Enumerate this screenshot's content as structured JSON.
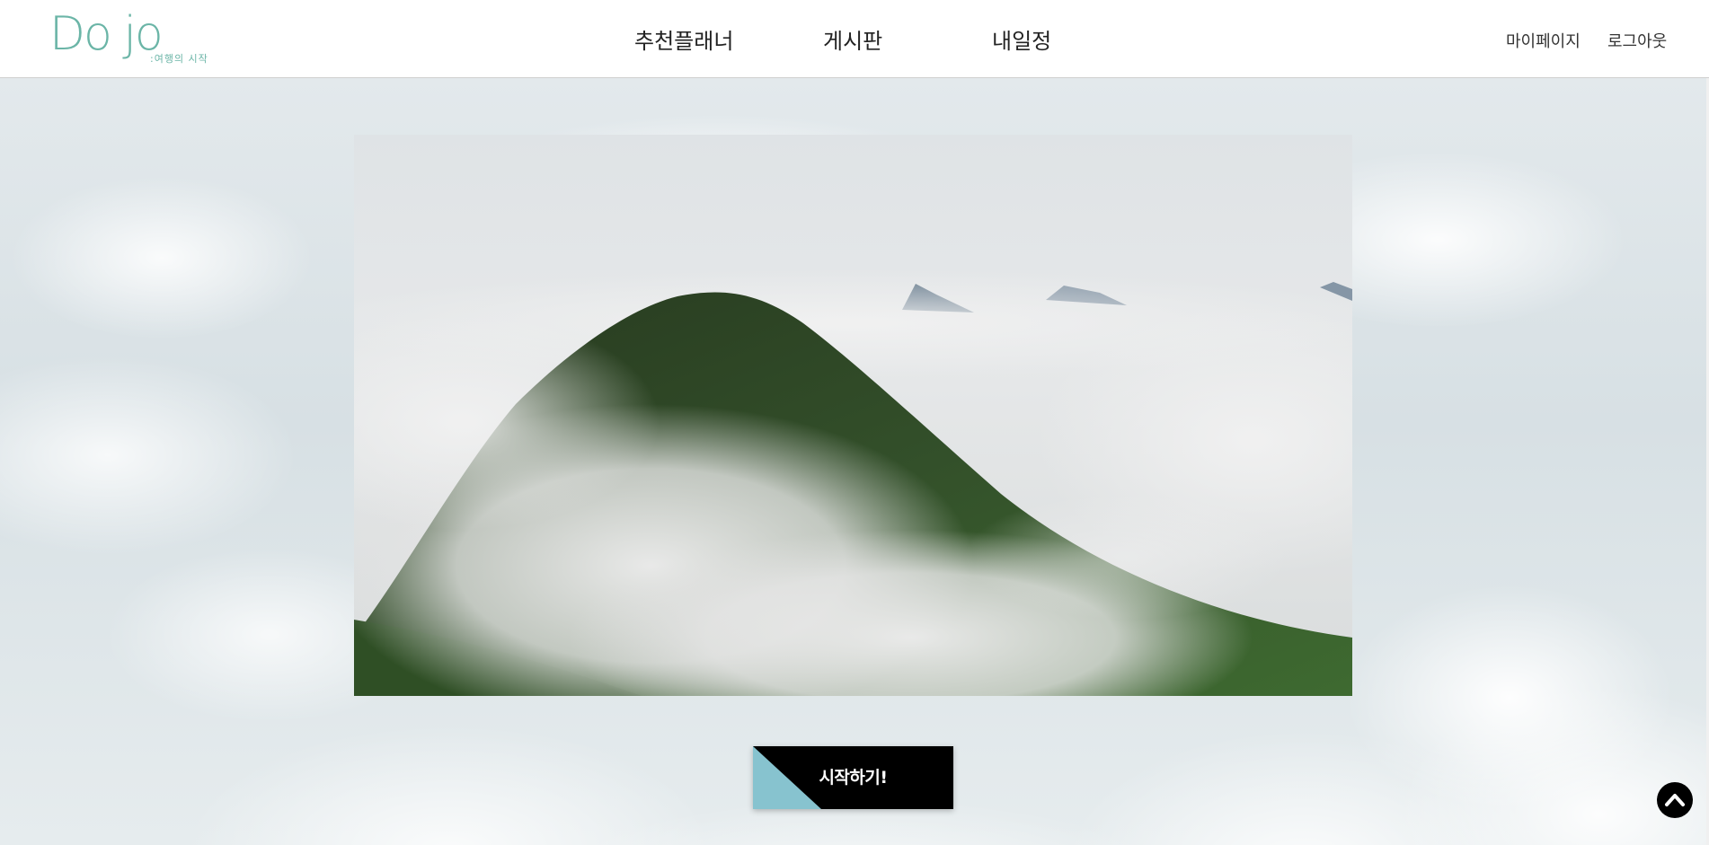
{
  "logo": {
    "main_left": "Do",
    "main_right": "jo",
    "subtitle": ":여행의 시작"
  },
  "nav": {
    "items": [
      {
        "label": "추천플래너"
      },
      {
        "label": "게시판"
      },
      {
        "label": "내일정"
      }
    ]
  },
  "user_menu": {
    "mypage": "마이페이지",
    "logout": "로그아웃"
  },
  "hero": {
    "image_description_icon": "mountain-in-clouds-image"
  },
  "cta": {
    "start_label": "시작하기!"
  },
  "icons": {
    "scroll_top": "chevron-up-icon"
  },
  "colors": {
    "brand": "#6bb5a7",
    "cta_accent": "#87c3cf",
    "cta_bg": "#000000"
  }
}
